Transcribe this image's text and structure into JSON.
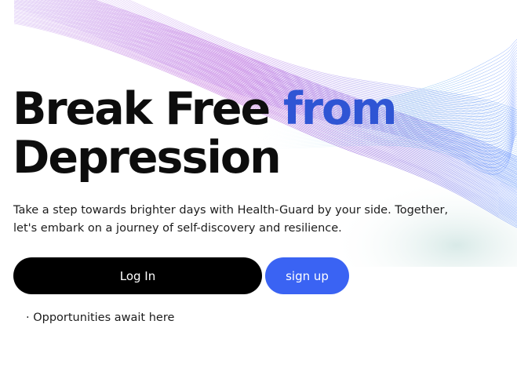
{
  "hero": {
    "headline_line1": "Break Free",
    "headline_accent": "from",
    "headline_line2": "Depression",
    "subtitle_line1": "Take a step towards brighter days with Health-Guard by your side. Together,",
    "subtitle_line2": "let's embark on a journey of self-discovery and resilience."
  },
  "actions": {
    "login_label": "Log In",
    "signup_label": "sign up"
  },
  "note": "· Opportunities await here",
  "colors": {
    "accent": "#2f55d4",
    "signup_bg": "#3a63f3",
    "login_bg": "#000000",
    "wave_purple": "#a020c8",
    "wave_blue": "#3a6cff"
  }
}
